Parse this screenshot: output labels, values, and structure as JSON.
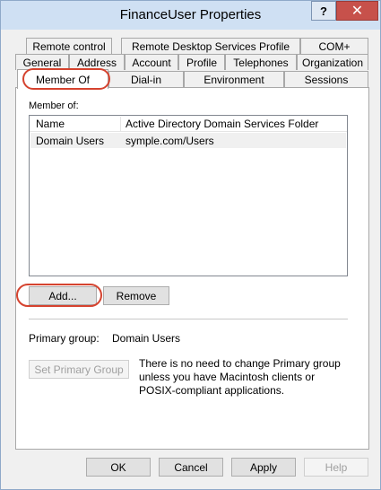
{
  "window": {
    "title": "FinanceUser Properties",
    "help_label": "?",
    "close_label": "✕"
  },
  "tabs": {
    "row1": [
      "Remote control",
      "Remote Desktop Services Profile",
      "COM+"
    ],
    "row2": [
      "General",
      "Address",
      "Account",
      "Profile",
      "Telephones",
      "Organization"
    ],
    "row3": [
      "Member Of",
      "Dial-in",
      "Environment",
      "Sessions"
    ],
    "active": "Member Of"
  },
  "member_of": {
    "label": "Member of:",
    "columns": [
      "Name",
      "Active Directory Domain Services Folder"
    ],
    "rows": [
      {
        "name": "Domain Users",
        "folder": "symple.com/Users"
      }
    ],
    "add_label": "Add...",
    "remove_label": "Remove"
  },
  "primary_group": {
    "label": "Primary group:",
    "value": "Domain Users",
    "set_button": "Set Primary Group",
    "note": "There is no need to change Primary group unless you have Macintosh clients or POSIX-compliant applications."
  },
  "footer": {
    "ok": "OK",
    "cancel": "Cancel",
    "apply": "Apply",
    "help": "Help"
  },
  "colors": {
    "titlebar": "#cfe0f3",
    "close_button": "#c7514b",
    "highlight": "#d5432f"
  }
}
